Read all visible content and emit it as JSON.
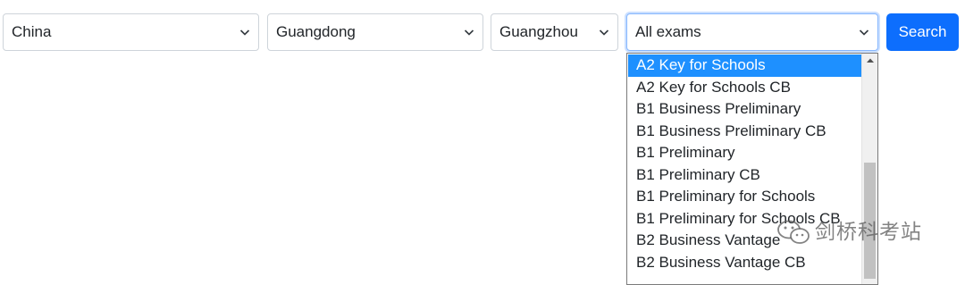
{
  "filters": {
    "country": "China",
    "province": "Guangdong",
    "city": "Guangzhou",
    "exam": "All exams"
  },
  "search_button": {
    "label": "Search"
  },
  "exam_dropdown": {
    "selected_index": 0,
    "options": [
      "A2 Key for Schools",
      "A2 Key for Schools CB",
      "B1 Business Preliminary",
      "B1 Business Preliminary CB",
      "B1 Preliminary",
      "B1 Preliminary CB",
      "B1 Preliminary for Schools",
      "B1 Preliminary for Schools CB",
      "B2 Business Vantage",
      "B2 Business Vantage CB"
    ]
  },
  "watermark": {
    "text": "剑桥科考站",
    "icon": "wechat-logo-icon"
  },
  "colors": {
    "primary": "#0d6efd",
    "option_highlight": "#1e90ff",
    "border": "#ced4da",
    "focus_border": "#86b7fe"
  }
}
